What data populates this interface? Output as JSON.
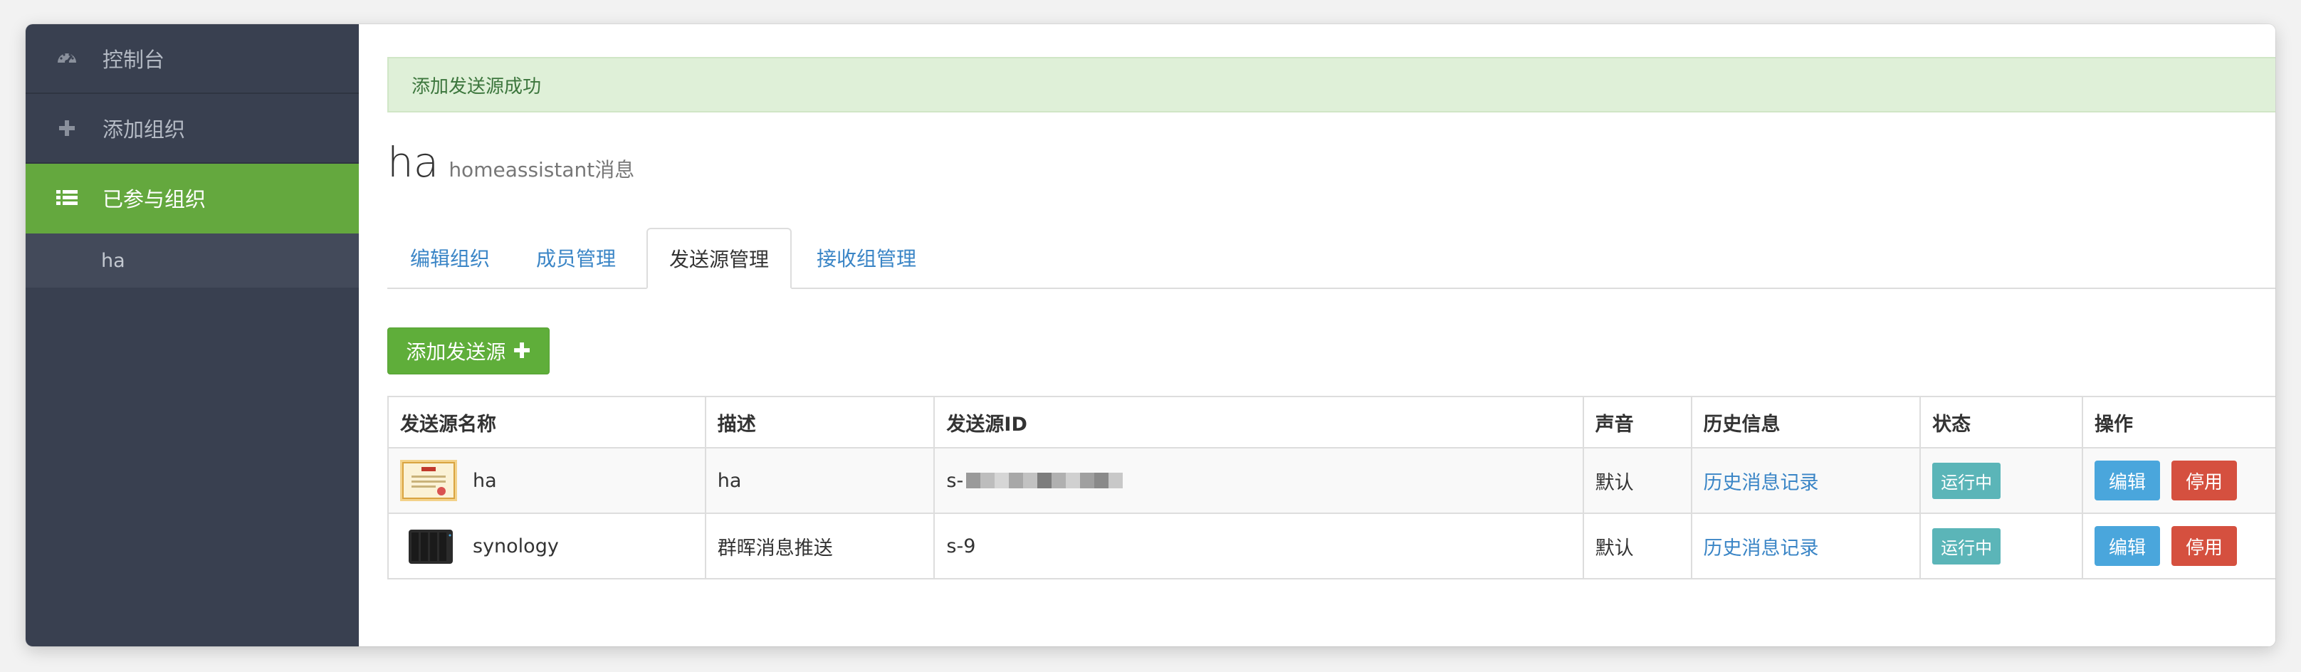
{
  "sidebar": {
    "items": [
      {
        "label": "控制台",
        "icon": "dashboard-icon"
      },
      {
        "label": "添加组织",
        "icon": "plus-icon"
      },
      {
        "label": "已参与组织",
        "icon": "list-icon"
      }
    ],
    "sub_items": [
      {
        "label": "ha"
      }
    ]
  },
  "main": {
    "alert": "添加发送源成功",
    "title": "ha",
    "subtitle": "homeassistant消息",
    "tabs": [
      {
        "label": "编辑组织"
      },
      {
        "label": "成员管理"
      },
      {
        "label": "发送源管理"
      },
      {
        "label": "接收组管理"
      }
    ],
    "add_button": {
      "label": "添加发送源",
      "icon": "plus-icon"
    }
  },
  "table": {
    "headers": [
      "发送源名称",
      "描述",
      "发送源ID",
      "声音",
      "历史信息",
      "状态",
      "操作"
    ],
    "rows": [
      {
        "name": "ha",
        "description": "ha",
        "id": "s-",
        "sound": "默认",
        "history": "历史消息记录",
        "status": "运行中",
        "edit": "编辑",
        "disable": "停用",
        "thumb": "certificate-thumbnail"
      },
      {
        "name": "synology",
        "description": "群晖消息推送",
        "id": "s-9",
        "sound": "默认",
        "history": "历史消息记录",
        "status": "运行中",
        "edit": "编辑",
        "disable": "停用",
        "thumb": "nas-device-thumbnail"
      }
    ]
  },
  "colors": {
    "sidebar_bg": "#394050",
    "sidebar_active": "#64a83e",
    "alert_bg": "#dff0d8",
    "link": "#3a85c6",
    "status_badge": "#5bb5b8",
    "edit_button": "#4aa6dc",
    "disable_button": "#d5503f"
  }
}
